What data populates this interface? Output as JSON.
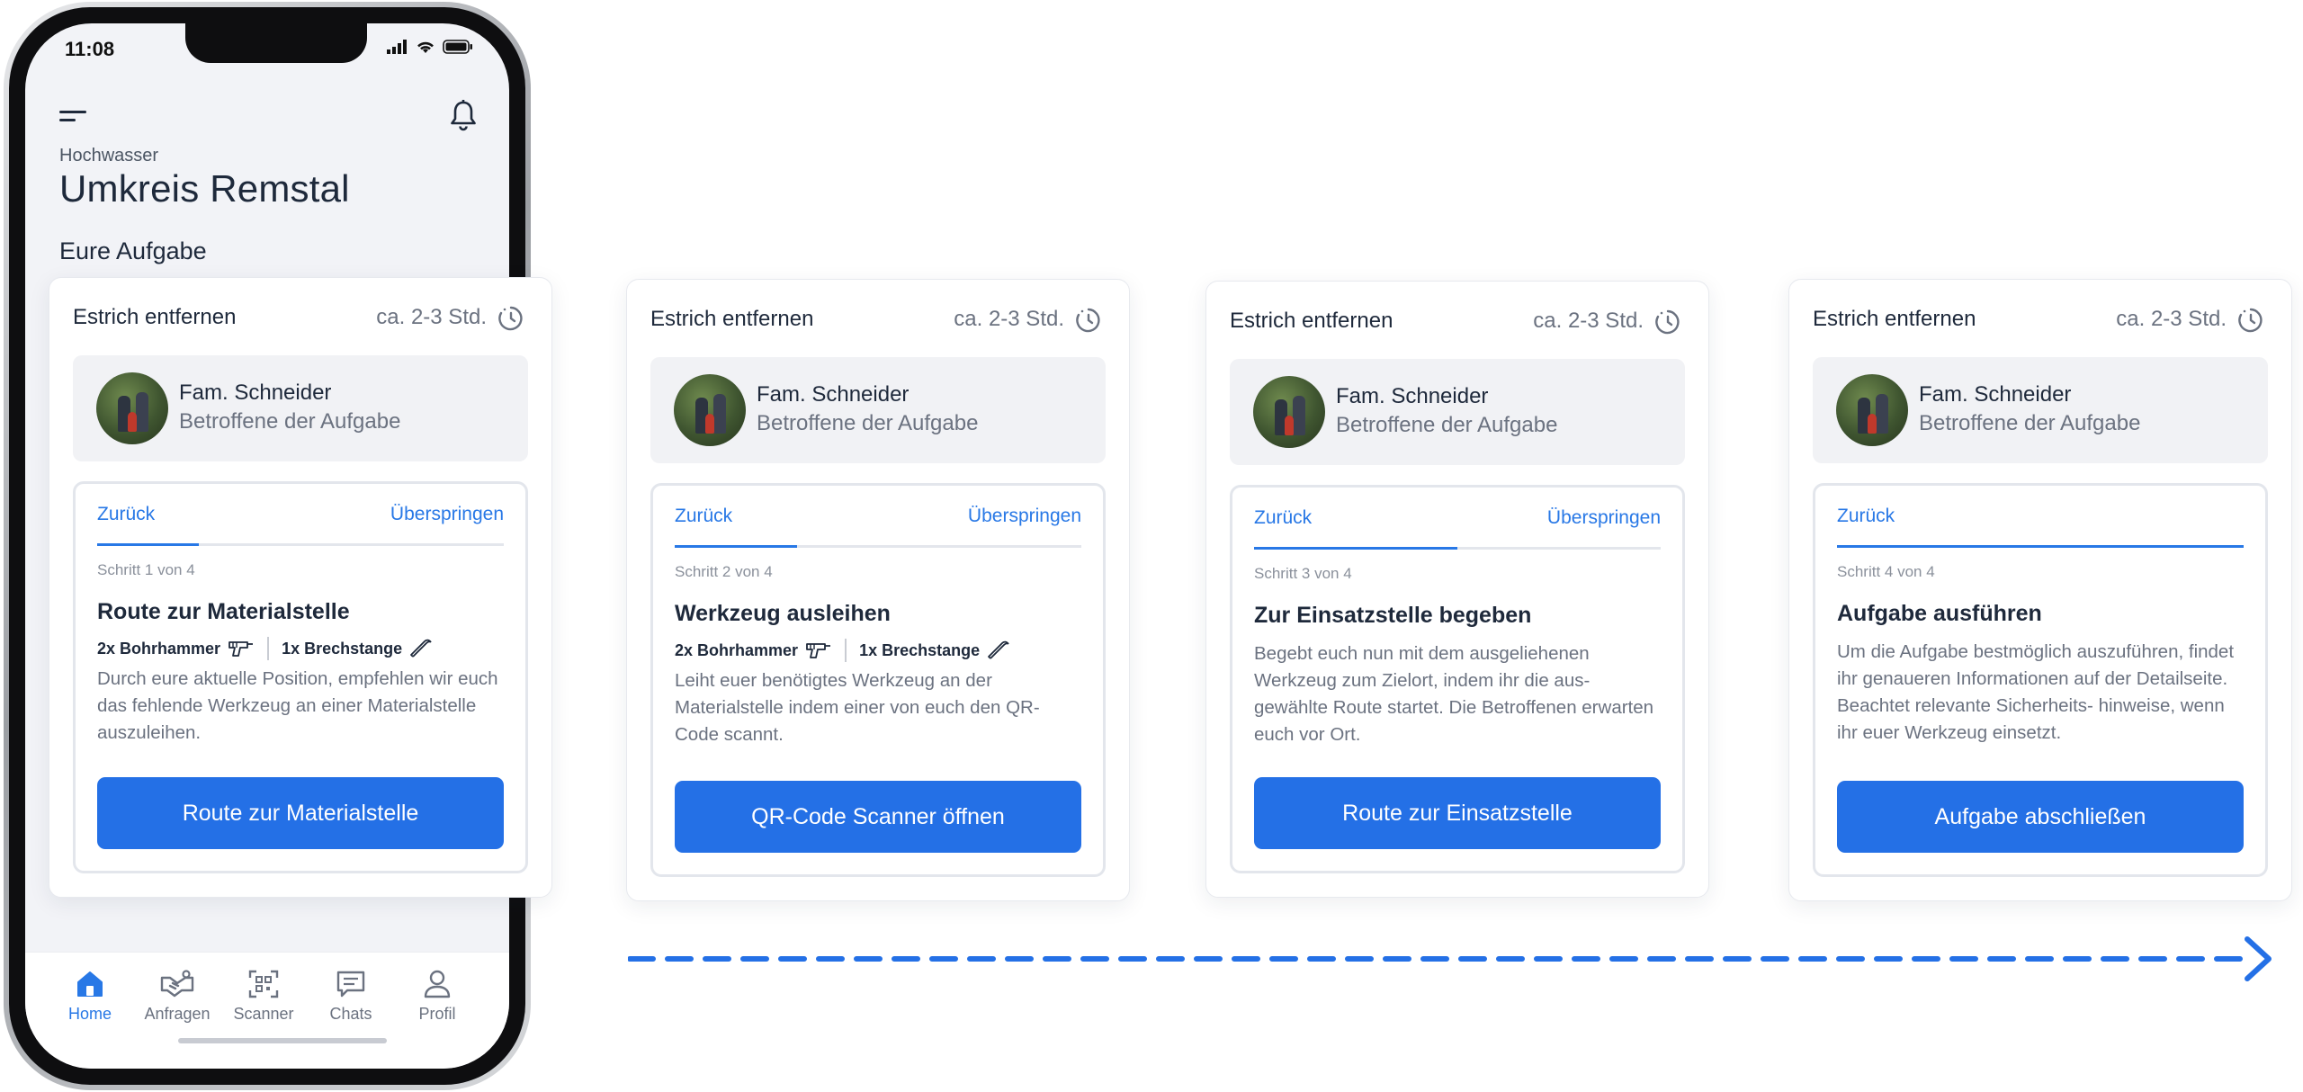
{
  "status_bar": {
    "time": "11:08"
  },
  "app": {
    "subtitle": "Hochwasser",
    "title": "Umkreis Remstal",
    "section_heading": "Eure Aufgabe",
    "tabs": [
      {
        "label": "Home",
        "icon": "home-icon",
        "active": true
      },
      {
        "label": "Anfragen",
        "icon": "handshake-icon",
        "active": false
      },
      {
        "label": "Scanner",
        "icon": "qr-scanner-icon",
        "active": false
      },
      {
        "label": "Chats",
        "icon": "chat-icon",
        "active": false
      },
      {
        "label": "Profil",
        "icon": "user-icon",
        "active": false
      }
    ]
  },
  "task": {
    "title": "Estrich entfernen",
    "duration": "ca. 2-3 Std.",
    "person_name": "Fam. Schneider",
    "person_role": "Betroffene der Aufgabe"
  },
  "steps": [
    {
      "back_label": "Zurück",
      "skip_label": "Überspringen",
      "count": "Schritt 1 von 4",
      "progress": 0.25,
      "title": "Route zur Materialstelle",
      "tools": [
        {
          "label": "2x Bohrhammer",
          "icon": "drill-icon"
        },
        {
          "label": "1x Brechstange",
          "icon": "crowbar-icon"
        }
      ],
      "description": "Durch eure aktuelle Position, empfehlen wir euch das fehlende Werkzeug an einer Materialstelle auszuleihen.",
      "button": "Route zur Materialstelle"
    },
    {
      "back_label": "Zurück",
      "skip_label": "Überspringen",
      "count": "Schritt 2 von 4",
      "progress": 0.3,
      "title": "Werkzeug ausleihen",
      "tools": [
        {
          "label": "2x Bohrhammer",
          "icon": "drill-icon"
        },
        {
          "label": "1x Brechstange",
          "icon": "crowbar-icon"
        }
      ],
      "description": "Leiht euer benötigtes Werkzeug an der Materialstelle indem einer von euch den QR-Code scannt.",
      "button": "QR-Code Scanner öffnen"
    },
    {
      "back_label": "Zurück",
      "skip_label": "Überspringen",
      "count": "Schritt 3 von 4",
      "progress": 0.5,
      "title": "Zur Einsatzstelle begeben",
      "tools": [],
      "description": "Begebt euch nun mit dem ausgeliehenen Werkzeug zum Zielort, indem ihr die aus- gewählte Route startet. Die Betroffenen erwarten euch vor Ort.",
      "button": "Route zur Einsatzstelle"
    },
    {
      "back_label": "Zurück",
      "skip_label": "",
      "count": "Schritt 4 von 4",
      "progress": 1.0,
      "title": "Aufgabe ausführen",
      "tools": [],
      "description": "Um die Aufgabe bestmöglich auszuführen, findet ihr genaueren Informationen auf der Detailseite. Beachtet relevante Sicherheits- hinweise, wenn ihr euer Werkzeug einsetzt.",
      "button": "Aufgabe abschließen"
    }
  ],
  "colors": {
    "accent": "#2470e6",
    "muted": "#6b7280",
    "text": "#1e293b"
  }
}
